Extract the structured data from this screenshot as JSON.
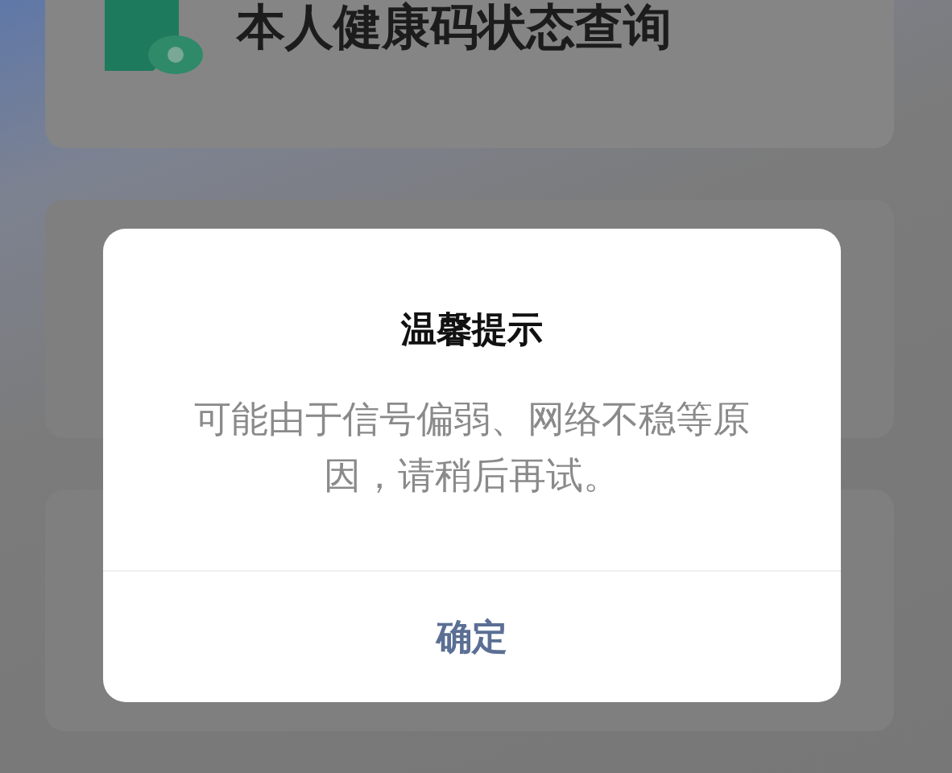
{
  "cards": [
    {
      "title": "本人健康码状态查询"
    }
  ],
  "dialog": {
    "title": "温馨提示",
    "message": "可能由于信号偏弱、网络不稳等原因，请稍后再试。",
    "button": "确定"
  }
}
